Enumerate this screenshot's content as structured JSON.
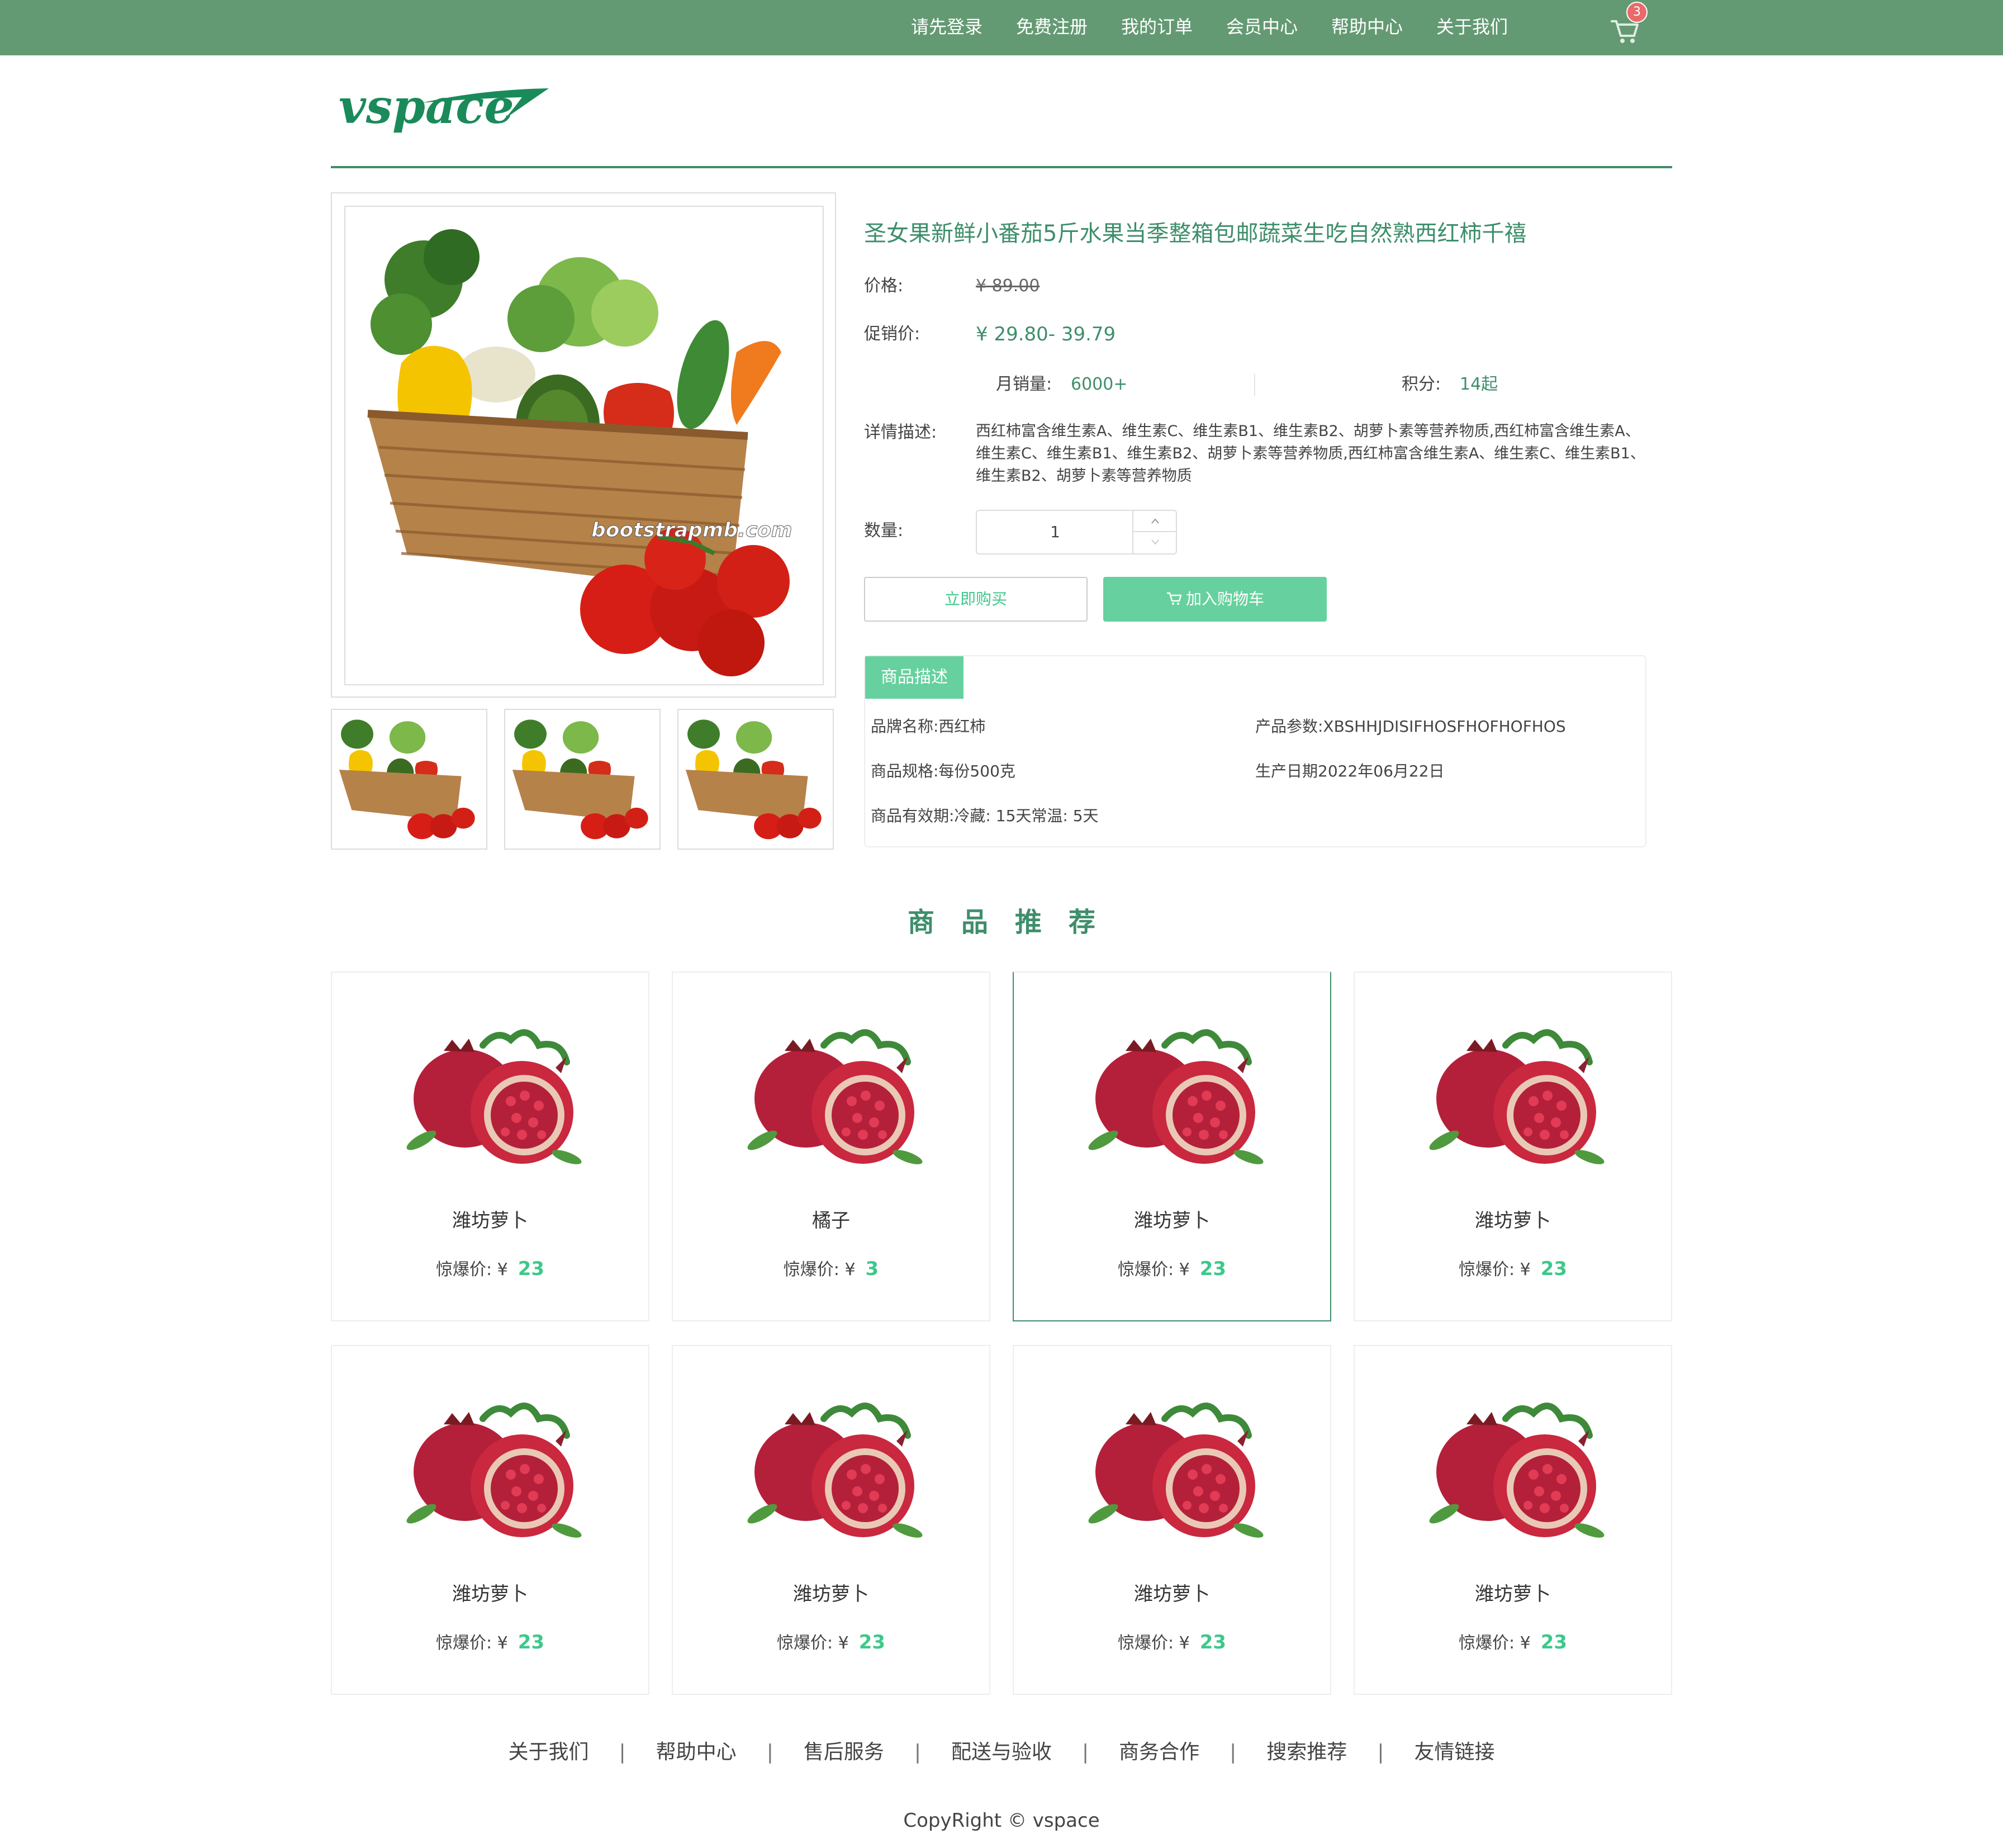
{
  "topbar": {
    "nav": [
      "请先登录",
      "免费注册",
      "我的订单",
      "会员中心",
      "帮助中心",
      "关于我们"
    ],
    "cart_count": "3"
  },
  "logo": {
    "text": "vspace"
  },
  "product": {
    "title": "圣女果新鲜小番茄5斤水果当季整箱包邮蔬菜生吃自然熟西红柿千禧",
    "price_label": "价格:",
    "price": "¥ 89.00",
    "promo_label": "促销价:",
    "promo_price": "¥ 29.80- 39.79",
    "monthly_sales_label": "月销量:",
    "monthly_sales": "6000+",
    "points_label": "积分:",
    "points": "14起",
    "detail_label": "详情描述:",
    "detail_text": "西红柿富含维生素A、维生素C、维生素B1、维生素B2、胡萝卜素等营养物质,西红柿富含维生素A、维生素C、维生素B1、维生素B2、胡萝卜素等营养物质,西红柿富含维生素A、维生素C、维生素B1、维生素B2、胡萝卜素等营养物质",
    "qty_label": "数量:",
    "qty": "1",
    "buy_now": "立即购买",
    "add_cart": "加入购物车",
    "image_watermark": "bootstrapmb.com"
  },
  "description": {
    "tab": "商品描述",
    "brand": "品牌名称:西红柿",
    "params": "产品参数:XBSHHJDISIFHOSFHOFHOFHOS",
    "spec": "商品规格:每份500克",
    "date": "生产日期2022年06月22日",
    "shelf_life": "商品有效期:冷藏: 15天常温: 5天"
  },
  "recommend": {
    "title": "商品推荐",
    "price_label": "惊爆价: ¥",
    "items": [
      {
        "name": "潍坊萝卜",
        "price": "23"
      },
      {
        "name": "橘子",
        "price": "3"
      },
      {
        "name": "潍坊萝卜",
        "price": "23"
      },
      {
        "name": "潍坊萝卜",
        "price": "23"
      },
      {
        "name": "潍坊萝卜",
        "price": "23"
      },
      {
        "name": "潍坊萝卜",
        "price": "23"
      },
      {
        "name": "潍坊萝卜",
        "price": "23"
      },
      {
        "name": "潍坊萝卜",
        "price": "23"
      }
    ]
  },
  "footer": {
    "links": [
      "关于我们",
      "帮助中心",
      "售后服务",
      "配送与验收",
      "商务合作",
      "搜索推荐",
      "友情链接"
    ],
    "copyright": "CopyRight © vspace"
  },
  "colors": {
    "topbar": "#649a73",
    "brand_green": "#3e8e6b",
    "button_green": "#66d19e",
    "price_green": "#3ec88b",
    "badge_red": "#e96a6a"
  }
}
